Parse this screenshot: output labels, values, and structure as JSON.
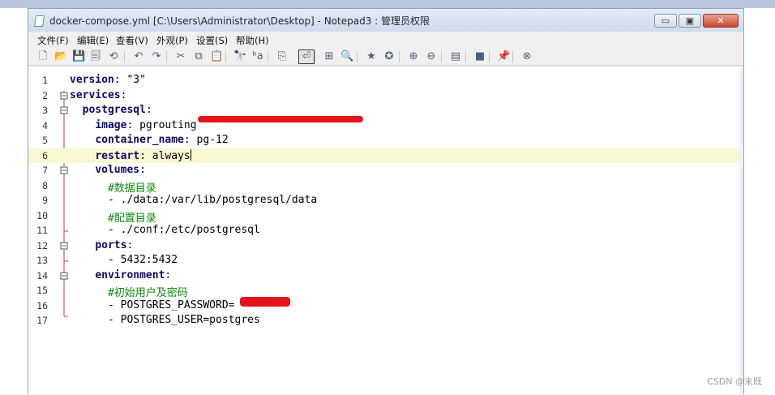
{
  "window": {
    "title": "docker-compose.yml [C:\\Users\\Administrator\\Desktop] - Notepad3 : 管理员权限",
    "minimize_glyph": "▭",
    "maximize_glyph": "▣",
    "close_glyph": "✕"
  },
  "menu": [
    "文件(F)",
    "编辑(E)",
    "查看(V)",
    "外观(P)",
    "设置(S)",
    "帮助(H)"
  ],
  "toolbar": [
    {
      "icon": "new-file-icon",
      "glyph": "🗋"
    },
    {
      "icon": "open-folder-icon",
      "glyph": "📂"
    },
    {
      "icon": "save-icon",
      "glyph": "💾"
    },
    {
      "icon": "save-all-icon",
      "glyph": "🗐"
    },
    {
      "icon": "history-icon",
      "glyph": "⟲"
    },
    {
      "icon": "undo-icon",
      "glyph": "↶"
    },
    {
      "icon": "redo-icon",
      "glyph": "↷"
    },
    {
      "icon": "cut-icon",
      "glyph": "✂"
    },
    {
      "icon": "copy-icon",
      "glyph": "⧉"
    },
    {
      "icon": "paste-icon",
      "glyph": "📋"
    },
    {
      "icon": "find-icon",
      "glyph": "🔭"
    },
    {
      "icon": "replace-icon",
      "glyph": "ᵇa"
    },
    {
      "icon": "goto-icon",
      "glyph": "⎘"
    },
    {
      "icon": "word-wrap-icon",
      "glyph": "⏎"
    },
    {
      "icon": "fold-icon",
      "glyph": "⊞"
    },
    {
      "icon": "zoom-view-icon",
      "glyph": "🔍"
    },
    {
      "icon": "favorites-icon",
      "glyph": "★"
    },
    {
      "icon": "add-favorite-icon",
      "glyph": "✪"
    },
    {
      "icon": "zoom-in-icon",
      "glyph": "⊕"
    },
    {
      "icon": "zoom-out-icon",
      "glyph": "⊖"
    },
    {
      "icon": "schemes-icon",
      "glyph": "▤"
    },
    {
      "icon": "customize-icon",
      "glyph": "■"
    },
    {
      "icon": "pin-icon",
      "glyph": "📌"
    },
    {
      "icon": "exit-icon",
      "glyph": "⊗"
    }
  ],
  "editor": {
    "current_line": 6,
    "lines": [
      {
        "n": "1",
        "parts": [
          {
            "t": "version",
            "c": "k"
          },
          {
            "t": ": \"3\"",
            "c": ""
          }
        ]
      },
      {
        "n": "2",
        "parts": [
          {
            "t": "services",
            "c": "k"
          },
          {
            "t": ":",
            "c": ""
          }
        ]
      },
      {
        "n": "3",
        "parts": [
          {
            "t": "  ",
            "c": ""
          },
          {
            "t": "postgresql",
            "c": "k"
          },
          {
            "t": ":",
            "c": ""
          }
        ]
      },
      {
        "n": "4",
        "parts": [
          {
            "t": "    ",
            "c": ""
          },
          {
            "t": "image",
            "c": "k"
          },
          {
            "t": ": pgrouting",
            "c": ""
          }
        ]
      },
      {
        "n": "5",
        "parts": [
          {
            "t": "    ",
            "c": ""
          },
          {
            "t": "container_name",
            "c": "k"
          },
          {
            "t": ": pg-12",
            "c": ""
          }
        ]
      },
      {
        "n": "6",
        "parts": [
          {
            "t": "    ",
            "c": ""
          },
          {
            "t": "restart",
            "c": "k"
          },
          {
            "t": ": always",
            "c": ""
          }
        ]
      },
      {
        "n": "7",
        "parts": [
          {
            "t": "    ",
            "c": ""
          },
          {
            "t": "volumes",
            "c": "k"
          },
          {
            "t": ":",
            "c": ""
          }
        ]
      },
      {
        "n": "8",
        "parts": [
          {
            "t": "      ",
            "c": ""
          },
          {
            "t": "#数据目录",
            "c": "cmt"
          }
        ]
      },
      {
        "n": "9",
        "parts": [
          {
            "t": "      - ./data:/var/lib/postgresql/data",
            "c": ""
          }
        ]
      },
      {
        "n": "10",
        "parts": [
          {
            "t": "      ",
            "c": ""
          },
          {
            "t": "#配置目录",
            "c": "cmt"
          }
        ]
      },
      {
        "n": "11",
        "parts": [
          {
            "t": "      - ./conf:/etc/postgresql",
            "c": ""
          }
        ]
      },
      {
        "n": "12",
        "parts": [
          {
            "t": "    ",
            "c": ""
          },
          {
            "t": "ports",
            "c": "k"
          },
          {
            "t": ":",
            "c": ""
          }
        ]
      },
      {
        "n": "13",
        "parts": [
          {
            "t": "      - 5432:5432",
            "c": ""
          }
        ]
      },
      {
        "n": "14",
        "parts": [
          {
            "t": "    ",
            "c": ""
          },
          {
            "t": "environment",
            "c": "k"
          },
          {
            "t": ":",
            "c": ""
          }
        ]
      },
      {
        "n": "15",
        "parts": [
          {
            "t": "      ",
            "c": ""
          },
          {
            "t": "#初始用户及密码",
            "c": "cmt"
          }
        ]
      },
      {
        "n": "16",
        "parts": [
          {
            "t": "      - POSTGRES_PASSWORD=",
            "c": ""
          }
        ]
      },
      {
        "n": "17",
        "parts": [
          {
            "t": "      - POSTGRES_USER=postgres",
            "c": ""
          }
        ]
      }
    ]
  },
  "watermark": "CSDN @末既"
}
